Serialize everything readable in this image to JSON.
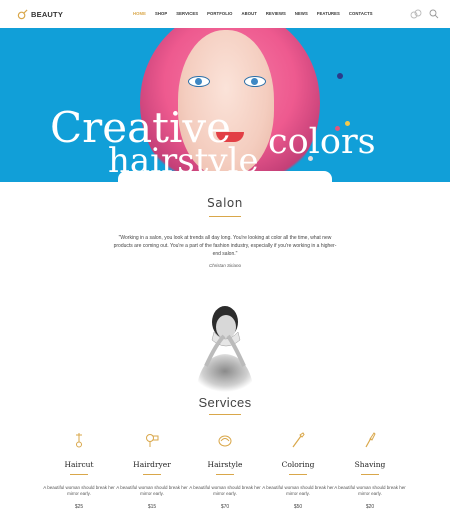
{
  "header": {
    "brand": "BEAUTY",
    "nav": [
      "HOME",
      "SHOP",
      "SERVICES",
      "PORTFOLIO",
      "ABOUT",
      "REVIEWS",
      "NEWS",
      "FEATURES",
      "CONTACTS"
    ],
    "icons": [
      "cart-icon",
      "search-icon"
    ]
  },
  "hero": {
    "line1": "Creative",
    "line2": "hairstyle",
    "line3": "colors"
  },
  "salon": {
    "title": "Salon",
    "quote": "\"Working in a salon, you look at trends all day long. You're looking at color all the time, what new products are coming out. You're a part of the fashion industry, especially if you're working in a higher-end salon.\"",
    "author": "Christan Siriano"
  },
  "services": {
    "title": "Services",
    "items": [
      {
        "name": "Haircut",
        "desc": "A beautiful woman should break her mirror early.",
        "price": "$25",
        "icon": "scissors-icon"
      },
      {
        "name": "Hairdryer",
        "desc": "A beautiful woman should break her mirror early.",
        "price": "$15",
        "icon": "hairdryer-icon"
      },
      {
        "name": "Hairstyle",
        "desc": "A beautiful woman should break her mirror early.",
        "price": "$70",
        "icon": "hair-icon"
      },
      {
        "name": "Coloring",
        "desc": "A beautiful woman should break her mirror early.",
        "price": "$50",
        "icon": "brush-icon"
      },
      {
        "name": "Shaving",
        "desc": "A beautiful woman should break her mirror early.",
        "price": "$20",
        "icon": "razor-icon"
      }
    ]
  },
  "colors": {
    "accent": "#d9a74a",
    "hero_bg": "#119fd8"
  }
}
